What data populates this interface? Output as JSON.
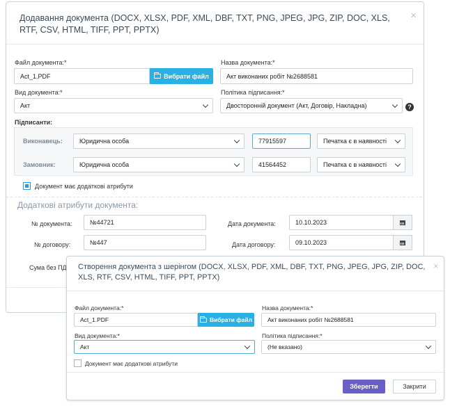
{
  "main_dialog": {
    "title": "Додавання документа (DOCX, XLSX, PDF, XML, DBF, TXT, PNG, JPEG, JPG, ZIP, DOC, XLS, RTF, CSV, HTML, TIFF, PPT, PPTX)",
    "file_label": "Файл документа:*",
    "file_value": "Act_1.PDF",
    "choose_file_label": "Вибрати файл",
    "name_label": "Назва документа:*",
    "name_value": "Акт виконаних робіт №2688581",
    "type_label": "Вид документа:*",
    "type_value": "Акт",
    "policy_label": "Політика підписання:*",
    "policy_value": "Двосторонній документ (Акт, Договір, Накладна)",
    "signers_label": "Підписанти:",
    "signers": [
      {
        "role": "Виконавець:",
        "entity": "Юридична особа",
        "code": "77915597",
        "stamp": "Печатка є в наявності"
      },
      {
        "role": "Замовник:",
        "entity": "Юридична особа",
        "code": "41564452",
        "stamp": "Печатка є в наявності"
      }
    ],
    "extra_attrs_checkbox": "Документ має додаткові атрибути",
    "extra_attrs_title": "Додаткові атрибути документа:",
    "doc_number_label": "№ документа:",
    "doc_number_value": "№44721",
    "doc_date_label": "Дата документа:",
    "doc_date_value": "10.10.2023",
    "contract_number_label": "№ договору:",
    "contract_number_value": "№447",
    "contract_date_label": "Дата договору:",
    "contract_date_value": "09.10.2023",
    "sum_label": "Сума без ПДВ"
  },
  "share_dialog": {
    "title": "Створення документа з шерінгом (DOCX, XLSX, PDF, XML, DBF, TXT, PNG, JPEG, JPG, ZIP, DOC, XLS, RTF, CSV, HTML, TIFF, PPT, PPTX)",
    "file_label": "Файл документа:*",
    "file_value": "Act_1.PDF",
    "choose_file_label": "Вибрати файл",
    "name_label": "Назва документа:*",
    "name_value": "Акт виконаних робіт №2688581",
    "type_label": "Вид документа:*",
    "type_value": "Акт",
    "policy_label": "Політика підписання:*",
    "policy_value": "(Не вказано)",
    "extra_attrs_checkbox": "Документ має додаткові атрибути",
    "save_label": "Зберегти",
    "close_label": "Закрити"
  },
  "colors": {
    "accent_blue": "#2ab0e3",
    "primary_purple": "#6a5fc4"
  },
  "icons": [
    "close-icon",
    "folder-icon",
    "chevron-down-icon",
    "help-icon",
    "calendar-icon",
    "checkbox-icon"
  ]
}
